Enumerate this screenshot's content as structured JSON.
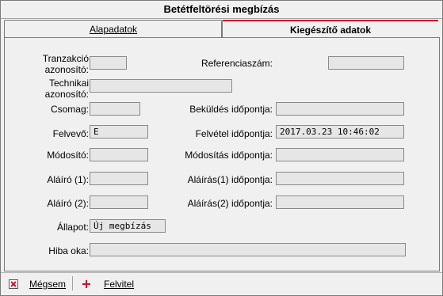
{
  "window": {
    "title": "Betétfeltörési megbízás"
  },
  "tabs": [
    {
      "label": "Alapadatok",
      "active": false
    },
    {
      "label": "Kiegészítő adatok",
      "active": true
    }
  ],
  "form": {
    "tranzakcio_label_1": "Tranzakció",
    "tranzakcio_label_2": "azonosító:",
    "tranzakcio_value": "",
    "referencia_label": "Referenciaszám:",
    "referencia_value": "",
    "technikai_label_1": "Technikai",
    "technikai_label_2": "azonosító:",
    "technikai_value": "",
    "csomag_label": "Csomag:",
    "csomag_value": "",
    "bekuldes_label": "Beküldés időpontja:",
    "bekuldes_value": "",
    "felvevo_label": "Felvevő:",
    "felvevo_value": "E",
    "felvetel_label": "Felvétel időpontja:",
    "felvetel_value": "2017.03.23 10:46:02",
    "modosito_label": "Módosító:",
    "modosito_value": "",
    "modositas_label": "Módosítás időpontja:",
    "modositas_value": "",
    "alairo1_label": "Aláíró (1):",
    "alairo1_value": "",
    "alairas1_label": "Aláírás(1) időpontja:",
    "alairas1_value": "",
    "alairo2_label": "Aláíró (2):",
    "alairo2_value": "",
    "alairas2_label": "Aláírás(2) időpontja:",
    "alairas2_value": "",
    "allapot_label": "Állapot:",
    "allapot_value": "Új megbízás",
    "hiba_label": "Hiba oka:",
    "hiba_value": ""
  },
  "toolbar": {
    "cancel_label": "Mégsem",
    "save_label": "Felvitel",
    "cancel_icon": "close-icon",
    "save_icon": "plus-icon",
    "accent": "#c8102e"
  }
}
